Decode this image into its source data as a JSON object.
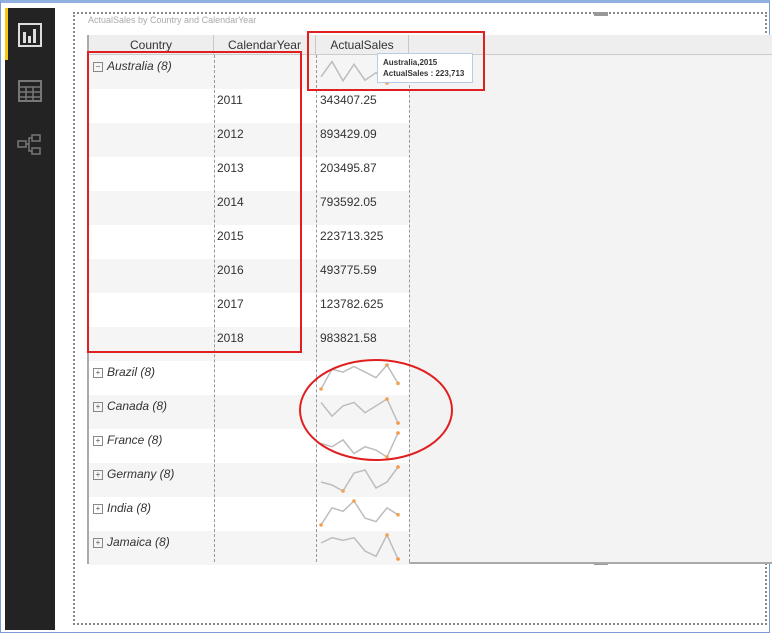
{
  "visual_title": "ActualSales by Country and CalendarYear",
  "sidebar": {
    "items": [
      {
        "icon": "report-view-icon"
      },
      {
        "icon": "data-view-icon"
      },
      {
        "icon": "model-view-icon"
      }
    ]
  },
  "columns": [
    "Country",
    "CalendarYear",
    "ActualSales"
  ],
  "rows": [
    {
      "country": "Australia (8)",
      "expanded": true,
      "spark": [
        343407,
        893429,
        203495,
        793592,
        223713,
        493775,
        123782,
        983821
      ]
    },
    {
      "year": "2011",
      "sales": "343407.25"
    },
    {
      "year": "2012",
      "sales": "893429.09"
    },
    {
      "year": "2013",
      "sales": "203495.87"
    },
    {
      "year": "2014",
      "sales": "793592.05"
    },
    {
      "year": "2015",
      "sales": "223713.325"
    },
    {
      "year": "2016",
      "sales": "493775.59"
    },
    {
      "year": "2017",
      "sales": "123782.625"
    },
    {
      "year": "2018",
      "sales": "983821.58"
    },
    {
      "country": "Brazil (8)",
      "spark": [
        1,
        8,
        7,
        9,
        7,
        5,
        9.5,
        3
      ]
    },
    {
      "country": "Canada (8)",
      "spark": [
        7,
        3,
        6,
        7,
        4,
        6,
        8,
        1
      ]
    },
    {
      "country": "France (8)",
      "spark": [
        5,
        4,
        6,
        2,
        4,
        3,
        1,
        8
      ]
    },
    {
      "country": "Germany (8)",
      "spark": [
        4,
        3,
        1,
        7,
        8,
        2,
        4,
        9
      ]
    },
    {
      "country": "India (8)",
      "spark": [
        1,
        6,
        5,
        8,
        3,
        2,
        6,
        4
      ]
    },
    {
      "country": "Jamaica (8)",
      "spark": [
        6,
        8,
        7,
        8,
        3,
        1,
        9,
        0
      ]
    }
  ],
  "tooltip": {
    "line1": "Australia,2015",
    "line2": "ActualSales : 223,713"
  },
  "colors": {
    "annotation": "#e02020",
    "spark_line": "#bdbdbd",
    "spark_marker": "#f0a050"
  }
}
